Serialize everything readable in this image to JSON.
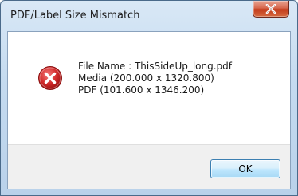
{
  "window": {
    "title": "PDF/Label Size Mismatch"
  },
  "titlebar": {
    "close_icon": "close-x-icon"
  },
  "message": {
    "icon": "error-icon",
    "lines": [
      "File Name : ThisSideUp_long.pdf",
      "Media (200.000 x 1320.800)",
      "PDF (101.600 x 1346.200)"
    ]
  },
  "buttons": {
    "ok_label": "OK"
  },
  "colors": {
    "error_red": "#d12a2a",
    "close_button": "#c43c1c",
    "ok_border": "#3c7fb1"
  }
}
